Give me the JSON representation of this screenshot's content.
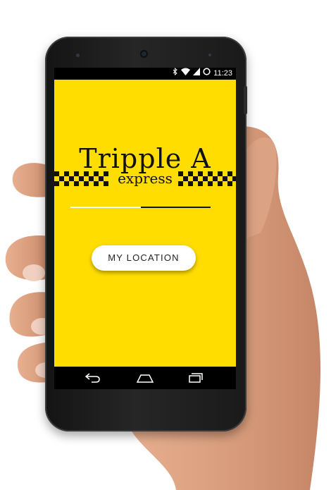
{
  "status_bar": {
    "time": "11:23",
    "icons": [
      "bluetooth-icon",
      "wifi-icon",
      "signal-icon",
      "alarm-icon"
    ]
  },
  "app": {
    "title": "Tripple A",
    "subtitle": "express",
    "loading_progress": 0.5,
    "location_button_label": "MY LOCATION",
    "brand_color": "#ffdd00"
  },
  "nav_bar": {
    "buttons": [
      "back-icon",
      "home-icon",
      "recent-apps-icon"
    ]
  }
}
